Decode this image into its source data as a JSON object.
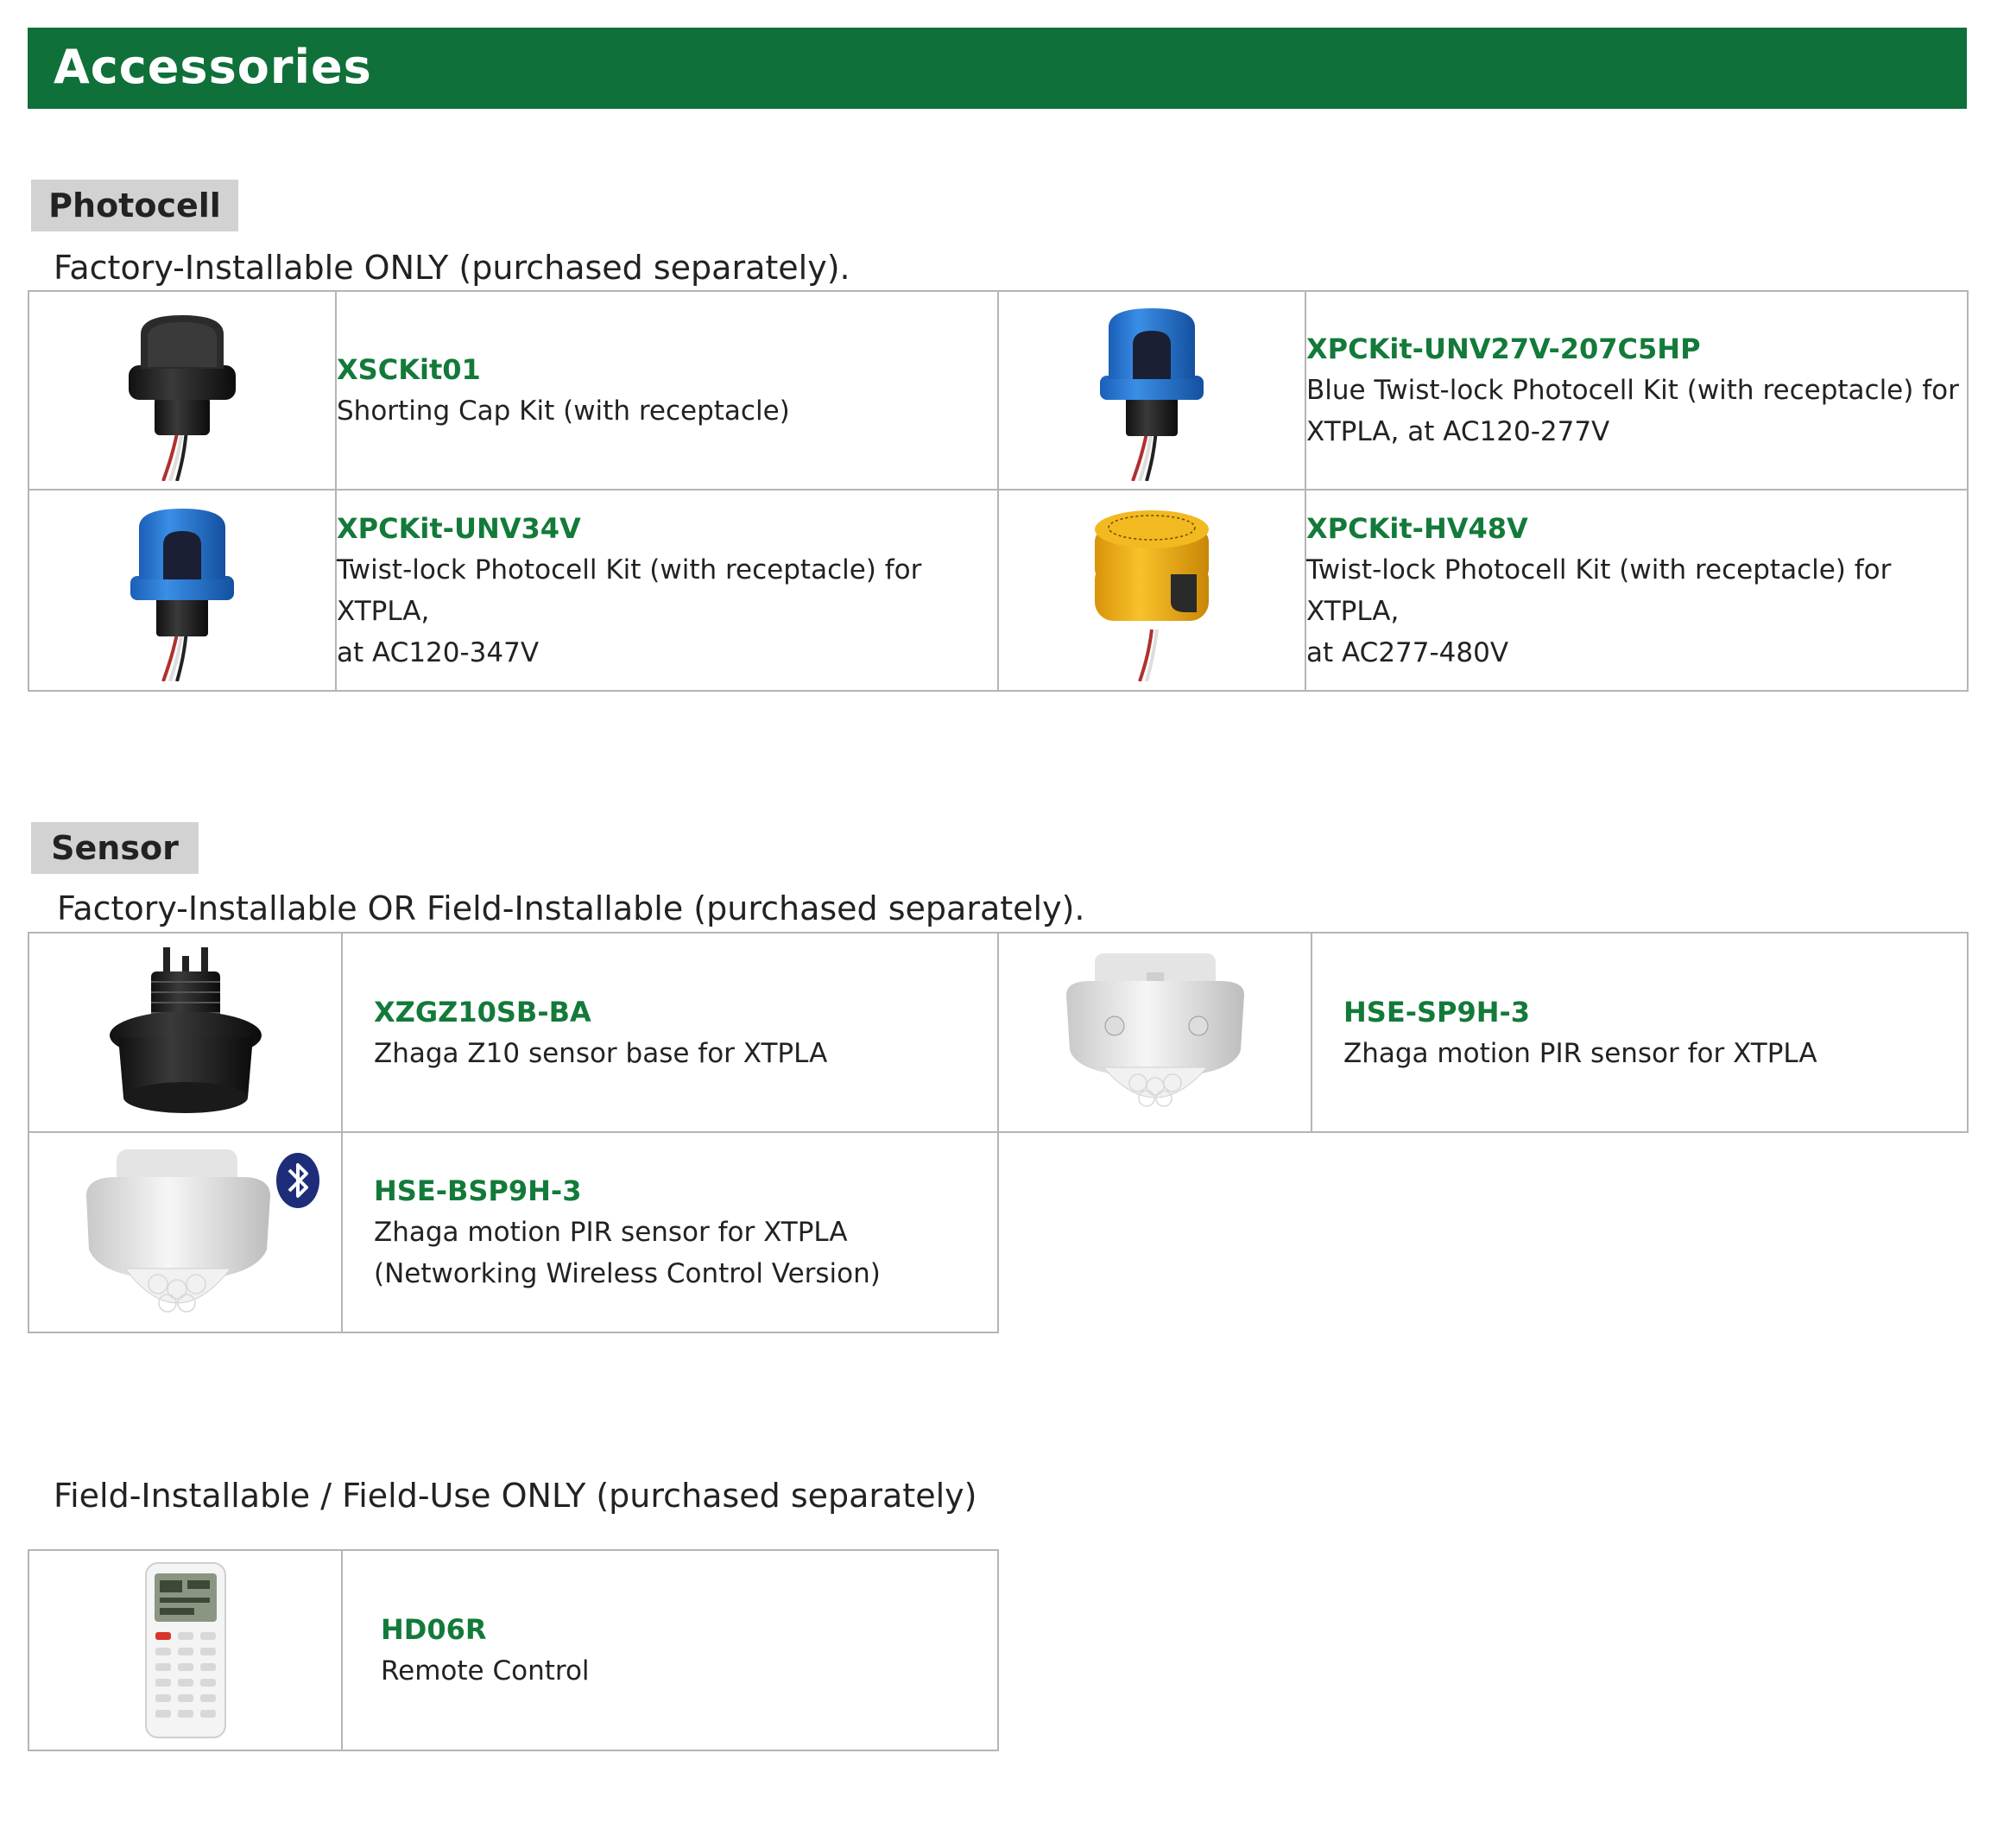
{
  "header": {
    "title": "Accessories"
  },
  "colors": {
    "brand_green": "#0f7039",
    "code_green": "#137a3a",
    "label_grey": "#d2d2d2"
  },
  "photocell": {
    "label": "Photocell",
    "note": "Factory-Installable ONLY (purchased separately).",
    "items": [
      {
        "code": "XSCKit01",
        "desc1": "Shorting Cap Kit (with receptacle)",
        "desc2": "",
        "icon": "black-shorting-cap-icon"
      },
      {
        "code": "XPCKit-UNV27V-207C5HP",
        "desc1": "Blue Twist-lock Photocell Kit (with receptacle) for",
        "desc2": "XTPLA, at AC120-277V",
        "icon": "blue-photocell-icon"
      },
      {
        "code": "XPCKit-UNV34V",
        "desc1": "Twist-lock Photocell Kit (with receptacle) for XTPLA,",
        "desc2": "at AC120-347V",
        "icon": "blue-photocell-icon"
      },
      {
        "code": "XPCKit-HV48V",
        "desc1": "Twist-lock Photocell Kit (with receptacle) for XTPLA,",
        "desc2": "at AC277-480V",
        "icon": "yellow-photocell-icon"
      }
    ]
  },
  "sensor": {
    "label": "Sensor",
    "note": "Factory-Installable OR Field-Installable (purchased separately).",
    "items": [
      {
        "code": "XZGZ10SB-BA",
        "desc1": "Zhaga Z10 sensor base for XTPLA",
        "desc2": "",
        "icon": "sensor-base-icon"
      },
      {
        "code": "HSE-SP9H-3",
        "desc1": "Zhaga motion PIR sensor for XTPLA",
        "desc2": "",
        "icon": "pir-sensor-icon"
      },
      {
        "code": "HSE-BSP9H-3",
        "desc1": "Zhaga motion PIR sensor for XTPLA",
        "desc2": "(Networking Wireless Control Version)",
        "icon": "bluetooth-pir-sensor-icon"
      }
    ]
  },
  "field": {
    "note": "Field-Installable / Field-Use ONLY (purchased separately)",
    "items": [
      {
        "code": "HD06R",
        "desc1": "Remote Control",
        "desc2": "",
        "icon": "remote-control-icon"
      }
    ]
  }
}
